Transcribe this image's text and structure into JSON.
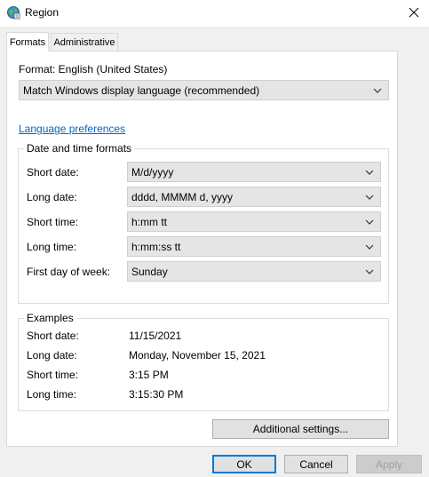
{
  "window": {
    "title": "Region",
    "close_glyph": "✕"
  },
  "tabs": [
    {
      "label": "Formats",
      "active": true
    },
    {
      "label": "Administrative",
      "active": false
    }
  ],
  "format": {
    "label": "Format: English (United States)",
    "selected": "Match Windows display language (recommended)"
  },
  "language_link": "Language preferences",
  "date_time": {
    "legend": "Date and time formats",
    "rows": [
      {
        "label": "Short date:",
        "value": "M/d/yyyy"
      },
      {
        "label": "Long date:",
        "value": "dddd, MMMM d, yyyy"
      },
      {
        "label": "Short time:",
        "value": "h:mm tt"
      },
      {
        "label": "Long time:",
        "value": "h:mm:ss tt"
      },
      {
        "label": "First day of week:",
        "value": "Sunday"
      }
    ]
  },
  "examples": {
    "legend": "Examples",
    "rows": [
      {
        "label": "Short date:",
        "value": "11/15/2021"
      },
      {
        "label": "Long date:",
        "value": "Monday, November 15, 2021"
      },
      {
        "label": "Short time:",
        "value": "3:15 PM"
      },
      {
        "label": "Long time:",
        "value": "3:15:30 PM"
      }
    ]
  },
  "buttons": {
    "additional": "Additional settings...",
    "ok": "OK",
    "cancel": "Cancel",
    "apply": "Apply"
  },
  "colors": {
    "link": "#0066cc",
    "dropdown_bg": "#e5e5e5",
    "focus_border": "#0078d7"
  }
}
